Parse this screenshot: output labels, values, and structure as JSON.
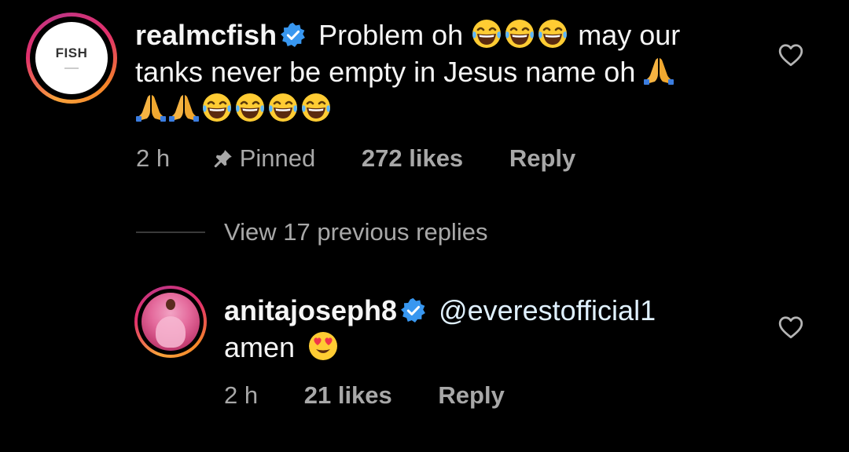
{
  "comment": {
    "username": "realmcfish",
    "avatar_text": "FISH",
    "text_line1": "Problem oh",
    "text_line1_end": "may our",
    "text_line2": "tanks never be empty in Jesus name oh",
    "time": "2 h",
    "pinned_label": "Pinned",
    "likes": "272 likes",
    "reply_label": "Reply"
  },
  "view_replies": "View 17 previous replies",
  "reply": {
    "username": "anitajoseph8",
    "mention": "@everestofficial1",
    "text": "amen",
    "time": "2 h",
    "likes": "21 likes",
    "reply_label": "Reply"
  },
  "icons": {
    "verified": "verified-badge-icon",
    "pin": "pin-icon",
    "heart": "heart-outline-icon",
    "laugh_emoji": "face-with-tears-of-joy",
    "pray_emoji": "folded-hands",
    "love_emoji": "smiling-face-with-heart-eyes"
  },
  "colors": {
    "verified": "#3897f0",
    "muted_text": "#a8a8a8",
    "mention": "#e0f1ff"
  }
}
